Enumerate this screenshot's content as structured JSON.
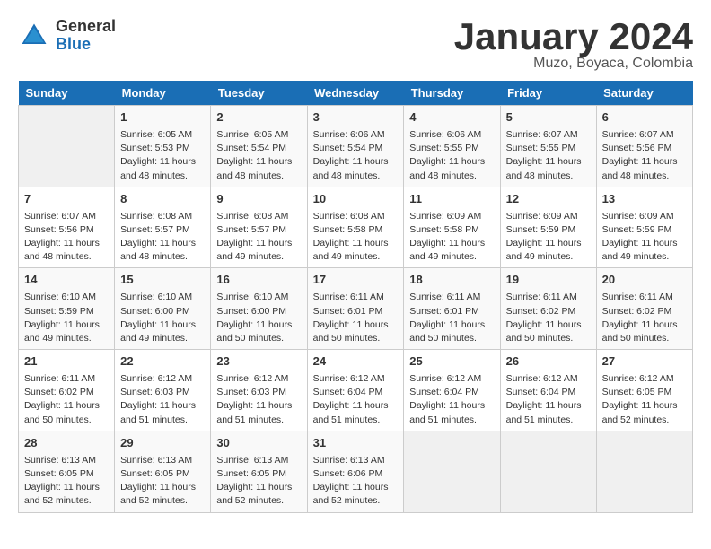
{
  "header": {
    "logo_general": "General",
    "logo_blue": "Blue",
    "month_title": "January 2024",
    "subtitle": "Muzo, Boyaca, Colombia"
  },
  "days_of_week": [
    "Sunday",
    "Monday",
    "Tuesday",
    "Wednesday",
    "Thursday",
    "Friday",
    "Saturday"
  ],
  "weeks": [
    [
      {
        "day": "",
        "info": ""
      },
      {
        "day": "1",
        "info": "Sunrise: 6:05 AM\nSunset: 5:53 PM\nDaylight: 11 hours\nand 48 minutes."
      },
      {
        "day": "2",
        "info": "Sunrise: 6:05 AM\nSunset: 5:54 PM\nDaylight: 11 hours\nand 48 minutes."
      },
      {
        "day": "3",
        "info": "Sunrise: 6:06 AM\nSunset: 5:54 PM\nDaylight: 11 hours\nand 48 minutes."
      },
      {
        "day": "4",
        "info": "Sunrise: 6:06 AM\nSunset: 5:55 PM\nDaylight: 11 hours\nand 48 minutes."
      },
      {
        "day": "5",
        "info": "Sunrise: 6:07 AM\nSunset: 5:55 PM\nDaylight: 11 hours\nand 48 minutes."
      },
      {
        "day": "6",
        "info": "Sunrise: 6:07 AM\nSunset: 5:56 PM\nDaylight: 11 hours\nand 48 minutes."
      }
    ],
    [
      {
        "day": "7",
        "info": "Sunrise: 6:07 AM\nSunset: 5:56 PM\nDaylight: 11 hours\nand 48 minutes."
      },
      {
        "day": "8",
        "info": "Sunrise: 6:08 AM\nSunset: 5:57 PM\nDaylight: 11 hours\nand 48 minutes."
      },
      {
        "day": "9",
        "info": "Sunrise: 6:08 AM\nSunset: 5:57 PM\nDaylight: 11 hours\nand 49 minutes."
      },
      {
        "day": "10",
        "info": "Sunrise: 6:08 AM\nSunset: 5:58 PM\nDaylight: 11 hours\nand 49 minutes."
      },
      {
        "day": "11",
        "info": "Sunrise: 6:09 AM\nSunset: 5:58 PM\nDaylight: 11 hours\nand 49 minutes."
      },
      {
        "day": "12",
        "info": "Sunrise: 6:09 AM\nSunset: 5:59 PM\nDaylight: 11 hours\nand 49 minutes."
      },
      {
        "day": "13",
        "info": "Sunrise: 6:09 AM\nSunset: 5:59 PM\nDaylight: 11 hours\nand 49 minutes."
      }
    ],
    [
      {
        "day": "14",
        "info": "Sunrise: 6:10 AM\nSunset: 5:59 PM\nDaylight: 11 hours\nand 49 minutes."
      },
      {
        "day": "15",
        "info": "Sunrise: 6:10 AM\nSunset: 6:00 PM\nDaylight: 11 hours\nand 49 minutes."
      },
      {
        "day": "16",
        "info": "Sunrise: 6:10 AM\nSunset: 6:00 PM\nDaylight: 11 hours\nand 50 minutes."
      },
      {
        "day": "17",
        "info": "Sunrise: 6:11 AM\nSunset: 6:01 PM\nDaylight: 11 hours\nand 50 minutes."
      },
      {
        "day": "18",
        "info": "Sunrise: 6:11 AM\nSunset: 6:01 PM\nDaylight: 11 hours\nand 50 minutes."
      },
      {
        "day": "19",
        "info": "Sunrise: 6:11 AM\nSunset: 6:02 PM\nDaylight: 11 hours\nand 50 minutes."
      },
      {
        "day": "20",
        "info": "Sunrise: 6:11 AM\nSunset: 6:02 PM\nDaylight: 11 hours\nand 50 minutes."
      }
    ],
    [
      {
        "day": "21",
        "info": "Sunrise: 6:11 AM\nSunset: 6:02 PM\nDaylight: 11 hours\nand 50 minutes."
      },
      {
        "day": "22",
        "info": "Sunrise: 6:12 AM\nSunset: 6:03 PM\nDaylight: 11 hours\nand 51 minutes."
      },
      {
        "day": "23",
        "info": "Sunrise: 6:12 AM\nSunset: 6:03 PM\nDaylight: 11 hours\nand 51 minutes."
      },
      {
        "day": "24",
        "info": "Sunrise: 6:12 AM\nSunset: 6:04 PM\nDaylight: 11 hours\nand 51 minutes."
      },
      {
        "day": "25",
        "info": "Sunrise: 6:12 AM\nSunset: 6:04 PM\nDaylight: 11 hours\nand 51 minutes."
      },
      {
        "day": "26",
        "info": "Sunrise: 6:12 AM\nSunset: 6:04 PM\nDaylight: 11 hours\nand 51 minutes."
      },
      {
        "day": "27",
        "info": "Sunrise: 6:12 AM\nSunset: 6:05 PM\nDaylight: 11 hours\nand 52 minutes."
      }
    ],
    [
      {
        "day": "28",
        "info": "Sunrise: 6:13 AM\nSunset: 6:05 PM\nDaylight: 11 hours\nand 52 minutes."
      },
      {
        "day": "29",
        "info": "Sunrise: 6:13 AM\nSunset: 6:05 PM\nDaylight: 11 hours\nand 52 minutes."
      },
      {
        "day": "30",
        "info": "Sunrise: 6:13 AM\nSunset: 6:05 PM\nDaylight: 11 hours\nand 52 minutes."
      },
      {
        "day": "31",
        "info": "Sunrise: 6:13 AM\nSunset: 6:06 PM\nDaylight: 11 hours\nand 52 minutes."
      },
      {
        "day": "",
        "info": ""
      },
      {
        "day": "",
        "info": ""
      },
      {
        "day": "",
        "info": ""
      }
    ]
  ]
}
